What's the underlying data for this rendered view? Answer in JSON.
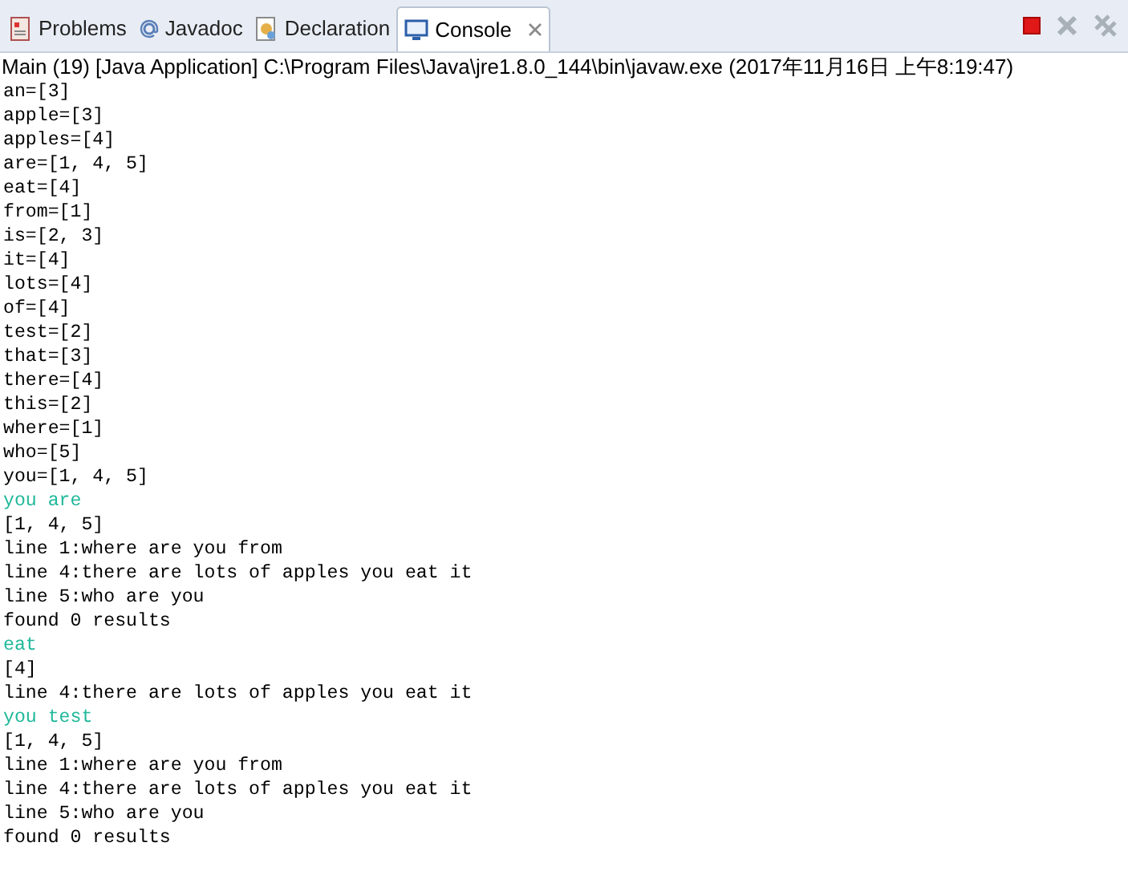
{
  "tabs": [
    {
      "label": "Problems",
      "kind": "problems",
      "selected": false
    },
    {
      "label": "Javadoc",
      "kind": "javadoc",
      "selected": false
    },
    {
      "label": "Declaration",
      "kind": "declaration",
      "selected": false
    },
    {
      "label": "Console",
      "kind": "console",
      "selected": true
    }
  ],
  "toolbar": [
    {
      "kind": "terminate",
      "disabled": false
    },
    {
      "kind": "remove",
      "disabled": true
    },
    {
      "kind": "remove_all",
      "disabled": true
    }
  ],
  "console": {
    "title": "Main (19) [Java Application] C:\\Program Files\\Java\\jre1.8.0_144\\bin\\javaw.exe (2017年11月16日 上午8:19:47)",
    "lines": [
      {
        "text": "an=[3]",
        "kind": "output"
      },
      {
        "text": "apple=[3]",
        "kind": "output"
      },
      {
        "text": "apples=[4]",
        "kind": "output"
      },
      {
        "text": "are=[1, 4, 5]",
        "kind": "output"
      },
      {
        "text": "eat=[4]",
        "kind": "output"
      },
      {
        "text": "from=[1]",
        "kind": "output"
      },
      {
        "text": "is=[2, 3]",
        "kind": "output"
      },
      {
        "text": "it=[4]",
        "kind": "output"
      },
      {
        "text": "lots=[4]",
        "kind": "output"
      },
      {
        "text": "of=[4]",
        "kind": "output"
      },
      {
        "text": "test=[2]",
        "kind": "output"
      },
      {
        "text": "that=[3]",
        "kind": "output"
      },
      {
        "text": "there=[4]",
        "kind": "output"
      },
      {
        "text": "this=[2]",
        "kind": "output"
      },
      {
        "text": "where=[1]",
        "kind": "output"
      },
      {
        "text": "who=[5]",
        "kind": "output"
      },
      {
        "text": "you=[1, 4, 5]",
        "kind": "output"
      },
      {
        "text": "you are",
        "kind": "input"
      },
      {
        "text": "[1, 4, 5]",
        "kind": "output"
      },
      {
        "text": "line 1:where are you from",
        "kind": "output"
      },
      {
        "text": "line 4:there are lots of apples you eat it",
        "kind": "output"
      },
      {
        "text": "line 5:who are you",
        "kind": "output"
      },
      {
        "text": "found 0 results",
        "kind": "output"
      },
      {
        "text": "eat",
        "kind": "input"
      },
      {
        "text": "[4]",
        "kind": "output"
      },
      {
        "text": "line 4:there are lots of apples you eat it",
        "kind": "output"
      },
      {
        "text": "you test",
        "kind": "input"
      },
      {
        "text": "[1, 4, 5]",
        "kind": "output"
      },
      {
        "text": "line 1:where are you from",
        "kind": "output"
      },
      {
        "text": "line 4:there are lots of apples you eat it",
        "kind": "output"
      },
      {
        "text": "line 5:who are you",
        "kind": "output"
      },
      {
        "text": "found 0 results",
        "kind": "output"
      }
    ]
  }
}
